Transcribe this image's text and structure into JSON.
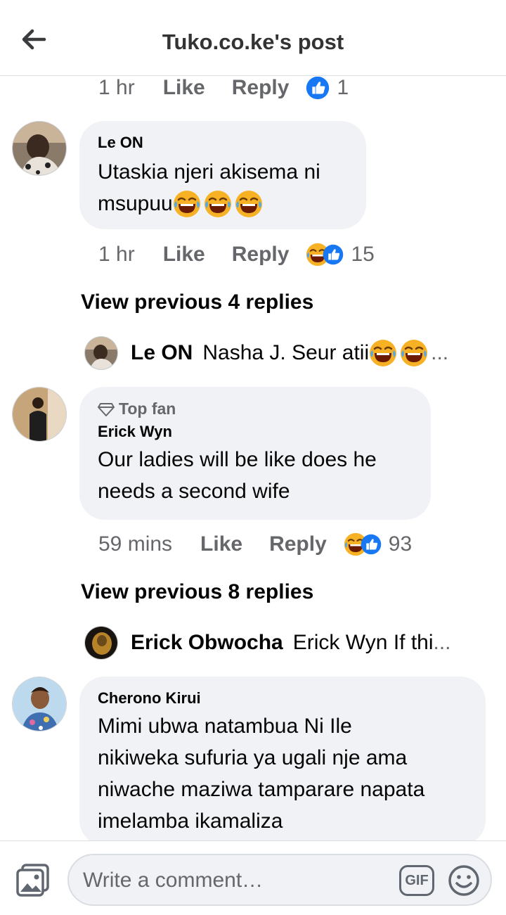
{
  "header": {
    "title": "Tuko.co.ke's post"
  },
  "top_meta": {
    "time": "1 hr",
    "like": "Like",
    "reply": "Reply",
    "count": "1"
  },
  "comments": [
    {
      "author": "Le ON",
      "lines": [
        "Utaskia njeri akisema ni",
        "msupuu"
      ],
      "time": "1 hr",
      "like": "Like",
      "reply": "Reply",
      "count": "15",
      "view_previous": "View previous 4 replies",
      "reply_preview": {
        "name": "Le ON",
        "text": "Nasha J. Seur atii",
        "ellipsis": "..."
      }
    },
    {
      "badge": "Top fan",
      "author": "Erick Wyn",
      "lines": [
        "Our  ladies will be like does he",
        "needs a second wife"
      ],
      "time": "59 mins",
      "like": "Like",
      "reply": "Reply",
      "count": "93",
      "view_previous": "View previous 8 replies",
      "reply_preview": {
        "name": "Erick Obwocha",
        "text": "Erick Wyn If thi",
        "ellipsis": "..."
      }
    },
    {
      "author": "Cherono Kirui",
      "lines": [
        "Mimi ubwa natambua Ni Ile",
        "nikiweka sufuria ya ugali nje ama",
        "niwache maziwa tamparare napata",
        "imelamba ikamaliza"
      ]
    }
  ],
  "composer": {
    "placeholder": "Write a comment…",
    "gif_label": "GIF"
  },
  "colors": {
    "like_blue": "#1877f2",
    "haha_yellow": "#f7b125",
    "bubble_bg": "#f0f2f5",
    "meta_gray": "#65676b"
  }
}
